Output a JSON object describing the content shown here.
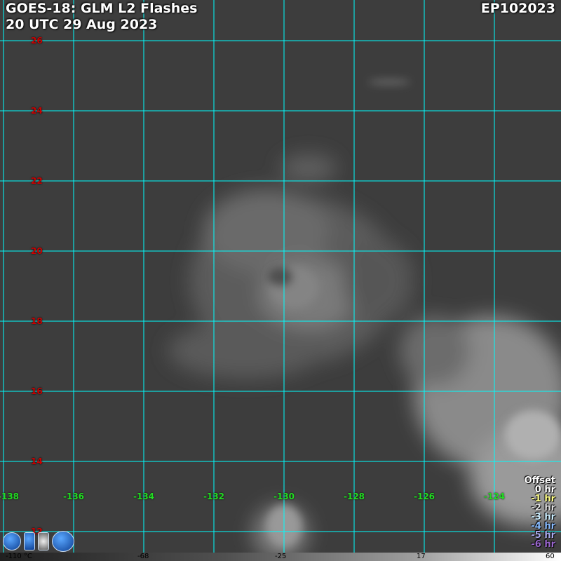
{
  "header": {
    "title": "GOES-18: GLM L2 Flashes",
    "datetime": "20 UTC 29 Aug 2023",
    "storm_id": "EP102023"
  },
  "map": {
    "lat_labels": [
      "26",
      "24",
      "22",
      "20",
      "18",
      "16",
      "14",
      "12"
    ],
    "lon_labels": [
      "-138",
      "-136",
      "-134",
      "-132",
      "-130",
      "-128",
      "-126",
      "-124"
    ],
    "gridline_color": "#00ffff",
    "lat_label_color": "#cc0000",
    "lon_label_color": "#22dd22"
  },
  "offset_legend": {
    "title": "Offset",
    "items": [
      {
        "label": "0 hr",
        "color": "#ffffff"
      },
      {
        "label": "-1 hr",
        "color": "#ffff88"
      },
      {
        "label": "-2 hr",
        "color": "#dddddd"
      },
      {
        "label": "-3 hr",
        "color": "#cceeff"
      },
      {
        "label": "-4 hr",
        "color": "#88bbff"
      },
      {
        "label": "-5 hr",
        "color": "#aaaaee"
      },
      {
        "label": "-6 hr",
        "color": "#9966cc"
      }
    ]
  },
  "colorbar": {
    "labels": [
      "-110 °C",
      "-68",
      "-25",
      "17",
      "60"
    ]
  },
  "logos": [
    "noaa-logo",
    "nesdis-logo",
    "cira-logo",
    "rammb-logo"
  ]
}
